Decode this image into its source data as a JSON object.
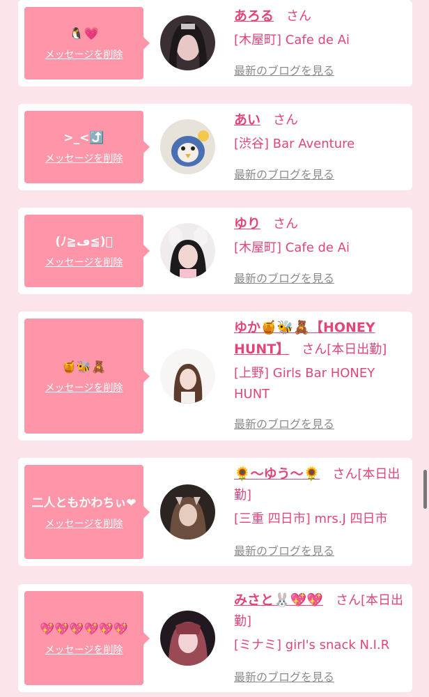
{
  "delete_label": "メッセージを削除",
  "blog_label": "最新のブログを見る",
  "san_label": "さん",
  "accent_color": "#e0467a",
  "bubble_color": "#ff95a8",
  "cards": [
    {
      "message": "🐧💗",
      "name": "あろる",
      "san": "さん",
      "shop": "[木屋町] Cafe de Ai"
    },
    {
      "message": ">_<⤴️",
      "name": "あい",
      "san": "さん",
      "shop": "[渋谷] Bar Aventure"
    },
    {
      "message": "(ﾉ≧ڡ≦)ﾞ",
      "name": "ゆり",
      "san": "さん",
      "shop": "[木屋町] Cafe de Ai"
    },
    {
      "message": "🍯🐝🧸",
      "name": "ゆか🍯🐝🧸【HONEY HUNT】",
      "san": "さん[本日出勤]",
      "shop": "[上野] Girls Bar HONEY HUNT"
    },
    {
      "message": "二人ともかわちぃ❤",
      "name": "🌻〜ゆう〜🌻",
      "san": "さん[本日出勤]",
      "shop": "[三重 四日市] mrs.J 四日市"
    },
    {
      "message": "💖💖💖💖💖💖",
      "name": "みさと🐰💖💖",
      "san": "さん[本日出勤]",
      "shop": "[ミナミ] girl's snack N.I.R"
    }
  ]
}
